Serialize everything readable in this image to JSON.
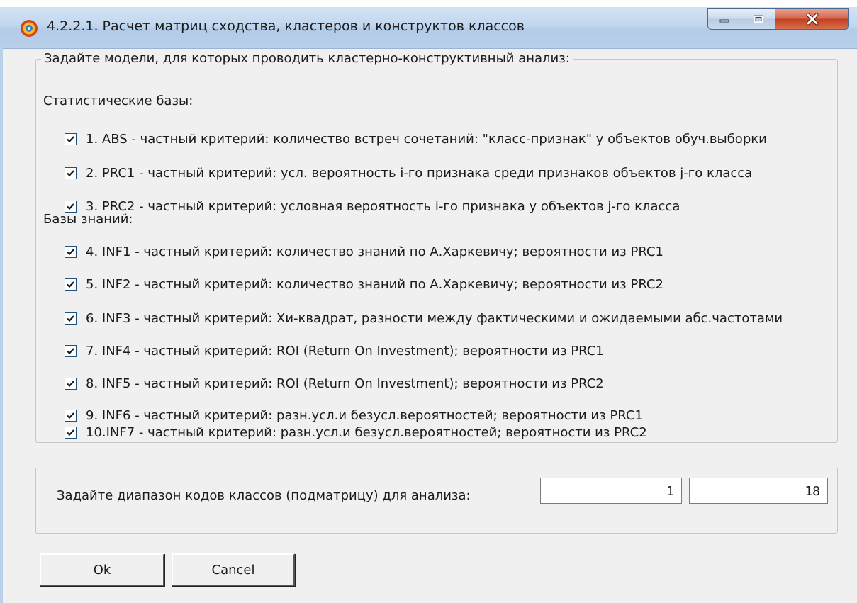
{
  "window": {
    "title": "4.2.2.1. Расчет матриц сходства, кластеров и конструктов классов",
    "icon": "app-logo-icon",
    "caption_buttons": [
      "minimize",
      "maximize",
      "close"
    ]
  },
  "models_group": {
    "legend": "Задайте модели, для которых проводить кластерно-конструктивный анализ:",
    "statistical_label": "Статистические базы:",
    "knowledge_label": "Базы знаний:",
    "statistical": [
      {
        "label": "1. ABS  - частный критерий: количество встреч сочетаний: \"класс-признак\" у объектов обуч.выборки",
        "checked": true
      },
      {
        "label": "2. PRC1 - частный критерий: усл. вероятность i-го признака среди признаков объектов j-го класса",
        "checked": true
      },
      {
        "label": "3. PRC2 - частный критерий: условная вероятность i-го признака у объектов j-го класса",
        "checked": true
      }
    ],
    "knowledge": [
      {
        "label": "4. INF1 - частный критерий: количество знаний по А.Харкевичу; вероятности из PRC1",
        "checked": true
      },
      {
        "label": "5. INF2 - частный критерий: количество знаний по А.Харкевичу; вероятности из PRC2",
        "checked": true
      },
      {
        "label": "6. INF3 - частный критерий: Хи-квадрат, разности между фактическими и ожидаемыми абс.частотами",
        "checked": true
      },
      {
        "label": "7. INF4 - частный критерий: ROI (Return On Investment); вероятности из PRC1",
        "checked": true
      },
      {
        "label": "8. INF5 - частный критерий: ROI (Return On Investment); вероятности из PRC2",
        "checked": true
      },
      {
        "label": "9. INF6 - частный критерий: разн.усл.и безусл.вероятностей; вероятности из PRC1",
        "checked": true
      },
      {
        "label": "10.INF7 - частный критерий: разн.усл.и безусл.вероятностей; вероятности из PRC2",
        "checked": true
      }
    ]
  },
  "range": {
    "label": "Задайте диапазон кодов классов (подматрицу) для анализа:",
    "from": "1",
    "to": "18"
  },
  "buttons": {
    "ok_accel": "O",
    "ok_rest": "k",
    "cancel_accel": "C",
    "cancel_rest": "ancel"
  }
}
